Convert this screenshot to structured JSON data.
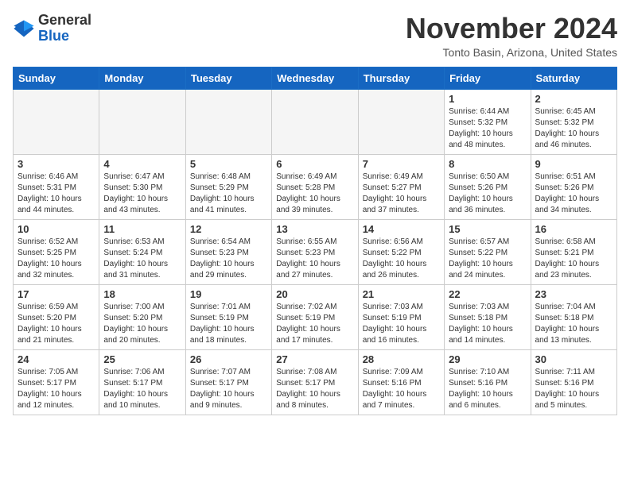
{
  "header": {
    "logo_general": "General",
    "logo_blue": "Blue",
    "month": "November 2024",
    "location": "Tonto Basin, Arizona, United States"
  },
  "days_of_week": [
    "Sunday",
    "Monday",
    "Tuesday",
    "Wednesday",
    "Thursday",
    "Friday",
    "Saturday"
  ],
  "weeks": [
    [
      {
        "day": "",
        "info": ""
      },
      {
        "day": "",
        "info": ""
      },
      {
        "day": "",
        "info": ""
      },
      {
        "day": "",
        "info": ""
      },
      {
        "day": "",
        "info": ""
      },
      {
        "day": "1",
        "info": "Sunrise: 6:44 AM\nSunset: 5:32 PM\nDaylight: 10 hours and 48 minutes."
      },
      {
        "day": "2",
        "info": "Sunrise: 6:45 AM\nSunset: 5:32 PM\nDaylight: 10 hours and 46 minutes."
      }
    ],
    [
      {
        "day": "3",
        "info": "Sunrise: 6:46 AM\nSunset: 5:31 PM\nDaylight: 10 hours and 44 minutes."
      },
      {
        "day": "4",
        "info": "Sunrise: 6:47 AM\nSunset: 5:30 PM\nDaylight: 10 hours and 43 minutes."
      },
      {
        "day": "5",
        "info": "Sunrise: 6:48 AM\nSunset: 5:29 PM\nDaylight: 10 hours and 41 minutes."
      },
      {
        "day": "6",
        "info": "Sunrise: 6:49 AM\nSunset: 5:28 PM\nDaylight: 10 hours and 39 minutes."
      },
      {
        "day": "7",
        "info": "Sunrise: 6:49 AM\nSunset: 5:27 PM\nDaylight: 10 hours and 37 minutes."
      },
      {
        "day": "8",
        "info": "Sunrise: 6:50 AM\nSunset: 5:26 PM\nDaylight: 10 hours and 36 minutes."
      },
      {
        "day": "9",
        "info": "Sunrise: 6:51 AM\nSunset: 5:26 PM\nDaylight: 10 hours and 34 minutes."
      }
    ],
    [
      {
        "day": "10",
        "info": "Sunrise: 6:52 AM\nSunset: 5:25 PM\nDaylight: 10 hours and 32 minutes."
      },
      {
        "day": "11",
        "info": "Sunrise: 6:53 AM\nSunset: 5:24 PM\nDaylight: 10 hours and 31 minutes."
      },
      {
        "day": "12",
        "info": "Sunrise: 6:54 AM\nSunset: 5:23 PM\nDaylight: 10 hours and 29 minutes."
      },
      {
        "day": "13",
        "info": "Sunrise: 6:55 AM\nSunset: 5:23 PM\nDaylight: 10 hours and 27 minutes."
      },
      {
        "day": "14",
        "info": "Sunrise: 6:56 AM\nSunset: 5:22 PM\nDaylight: 10 hours and 26 minutes."
      },
      {
        "day": "15",
        "info": "Sunrise: 6:57 AM\nSunset: 5:22 PM\nDaylight: 10 hours and 24 minutes."
      },
      {
        "day": "16",
        "info": "Sunrise: 6:58 AM\nSunset: 5:21 PM\nDaylight: 10 hours and 23 minutes."
      }
    ],
    [
      {
        "day": "17",
        "info": "Sunrise: 6:59 AM\nSunset: 5:20 PM\nDaylight: 10 hours and 21 minutes."
      },
      {
        "day": "18",
        "info": "Sunrise: 7:00 AM\nSunset: 5:20 PM\nDaylight: 10 hours and 20 minutes."
      },
      {
        "day": "19",
        "info": "Sunrise: 7:01 AM\nSunset: 5:19 PM\nDaylight: 10 hours and 18 minutes."
      },
      {
        "day": "20",
        "info": "Sunrise: 7:02 AM\nSunset: 5:19 PM\nDaylight: 10 hours and 17 minutes."
      },
      {
        "day": "21",
        "info": "Sunrise: 7:03 AM\nSunset: 5:19 PM\nDaylight: 10 hours and 16 minutes."
      },
      {
        "day": "22",
        "info": "Sunrise: 7:03 AM\nSunset: 5:18 PM\nDaylight: 10 hours and 14 minutes."
      },
      {
        "day": "23",
        "info": "Sunrise: 7:04 AM\nSunset: 5:18 PM\nDaylight: 10 hours and 13 minutes."
      }
    ],
    [
      {
        "day": "24",
        "info": "Sunrise: 7:05 AM\nSunset: 5:17 PM\nDaylight: 10 hours and 12 minutes."
      },
      {
        "day": "25",
        "info": "Sunrise: 7:06 AM\nSunset: 5:17 PM\nDaylight: 10 hours and 10 minutes."
      },
      {
        "day": "26",
        "info": "Sunrise: 7:07 AM\nSunset: 5:17 PM\nDaylight: 10 hours and 9 minutes."
      },
      {
        "day": "27",
        "info": "Sunrise: 7:08 AM\nSunset: 5:17 PM\nDaylight: 10 hours and 8 minutes."
      },
      {
        "day": "28",
        "info": "Sunrise: 7:09 AM\nSunset: 5:16 PM\nDaylight: 10 hours and 7 minutes."
      },
      {
        "day": "29",
        "info": "Sunrise: 7:10 AM\nSunset: 5:16 PM\nDaylight: 10 hours and 6 minutes."
      },
      {
        "day": "30",
        "info": "Sunrise: 7:11 AM\nSunset: 5:16 PM\nDaylight: 10 hours and 5 minutes."
      }
    ]
  ]
}
